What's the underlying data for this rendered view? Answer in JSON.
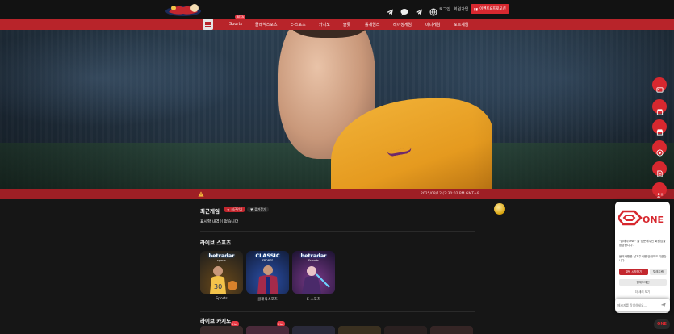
{
  "header": {
    "login_label": "로그인",
    "join_label": "회원가입",
    "promo_label": "이벤트&프로모션",
    "icons": [
      "telegram-icon",
      "chat-icon",
      "telegram-alt-icon",
      "globe-icon"
    ]
  },
  "nav": {
    "beta_badge": "BETA",
    "items": [
      "Sports",
      "클래식스포츠",
      "E-스포츠",
      "카지노",
      "슬롯",
      "롤게임스",
      "레이싱게임",
      "미니게임",
      "포르게임"
    ]
  },
  "ticker": {
    "datetime": "2025/08/12 (2:30:02 PM GMT+9"
  },
  "recent": {
    "title": "최근게임",
    "chip_popular": "최근인기",
    "chip_favorite": "즐겨찾기",
    "empty_message": "표시할 내역이 없습니다"
  },
  "live_sports": {
    "title": "라이브 스포츠",
    "cards": [
      {
        "brand": "betradar",
        "sub": "sports",
        "label": "Sports"
      },
      {
        "brand": "CLASSIC",
        "sub": "SPORTS",
        "label": "클래식스포츠"
      },
      {
        "brand": "betradar",
        "sub": "Esports",
        "label": "E-스포츠"
      }
    ]
  },
  "live_casino": {
    "title": "라이브 카지노",
    "hot_badge": "Hot"
  },
  "chat": {
    "brand": "ONE",
    "greeting": "\"클래식ONE\" 을 방문해주신 회원님을 환영합니다.",
    "prompt": "문의사항을 남겨주시면 안내해드리겠습니다.",
    "btn_start": "채팅 시작하기",
    "btn_telegram": "텔레그램",
    "btn_domain": "현재도메인",
    "more": "더 새리 보기",
    "input_placeholder": "메시지를 작성하세요..."
  },
  "colors": {
    "accent": "#d7282f",
    "nav_red": "#b8242a",
    "ticker_red": "#9e1f25",
    "background": "#161616"
  }
}
